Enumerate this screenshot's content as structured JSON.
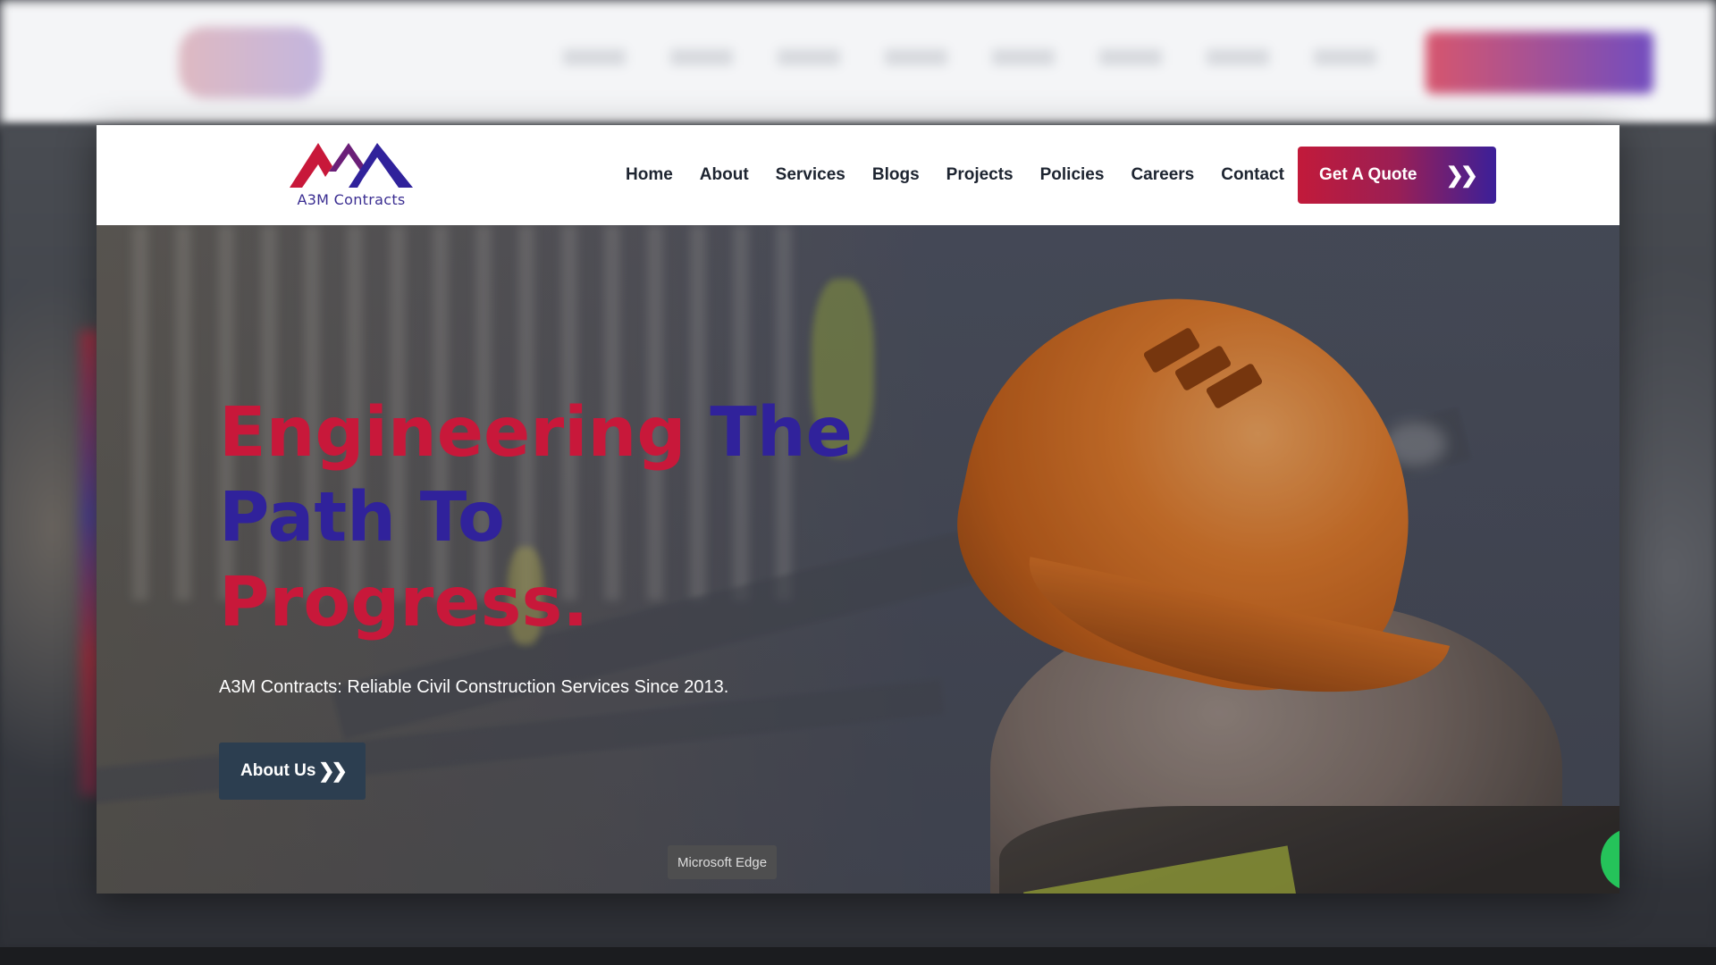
{
  "window": {
    "app_name": "Microsoft Edge"
  },
  "logo": {
    "text": "A3M Contracts",
    "colors": {
      "red": "#c8183a",
      "blue": "#30229b"
    }
  },
  "nav": {
    "items": [
      {
        "label": "Home"
      },
      {
        "label": "About"
      },
      {
        "label": "Services"
      },
      {
        "label": "Blogs"
      },
      {
        "label": "Projects"
      },
      {
        "label": "Policies"
      },
      {
        "label": "Careers"
      },
      {
        "label": "Contact"
      }
    ],
    "cta_label": "Get A Quote",
    "cta_icon": "double-chevron-right-icon"
  },
  "hero": {
    "title_line1_red": "Engineering",
    "title_line1_blue": "The",
    "title_line2_blue": "Path To",
    "title_line3_red": "Progress.",
    "subtitle": "A3M Contracts: Reliable Civil Construction Services Since 2013.",
    "button_label": "About Us",
    "button_icon": "double-chevron-right-icon"
  },
  "widgets": {
    "chat_bubble_icon": "whatsapp-icon"
  },
  "colors": {
    "accent_red": "#c8183a",
    "accent_blue": "#30229b",
    "button_dark": "#2c3e50"
  }
}
